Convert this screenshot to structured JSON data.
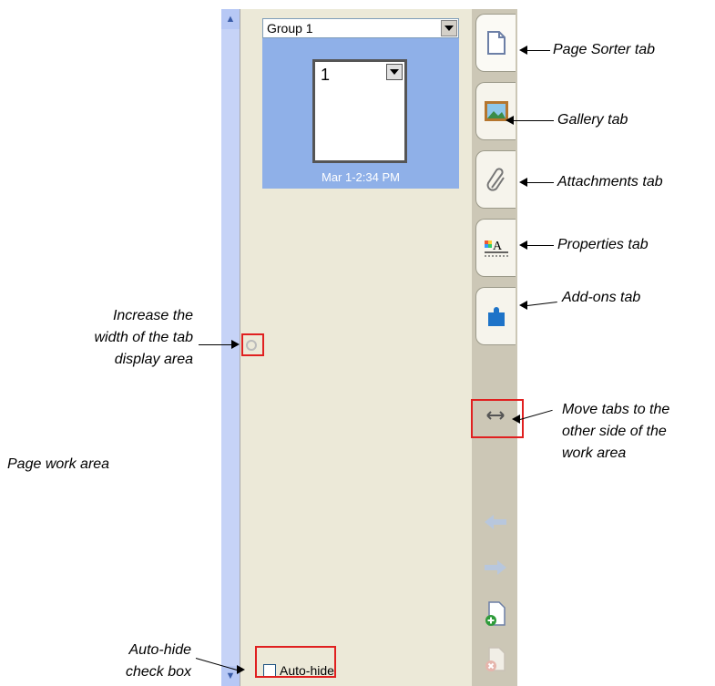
{
  "panel": {
    "group_select_value": "Group 1",
    "page_number": "1",
    "page_timestamp": "Mar 1-2:34 PM",
    "autohide_label": "Auto-hide",
    "autohide_checked": false
  },
  "tabs": [
    {
      "name": "Page Sorter",
      "icon": "page-icon",
      "active": true
    },
    {
      "name": "Gallery",
      "icon": "picture-icon",
      "active": false
    },
    {
      "name": "Attachments",
      "icon": "paperclip-icon",
      "active": false
    },
    {
      "name": "Properties",
      "icon": "properties-icon",
      "active": false
    },
    {
      "name": "Add-ons",
      "icon": "puzzle-icon",
      "active": false
    }
  ],
  "callouts": {
    "page_sorter": "Page Sorter tab",
    "gallery": "Gallery tab",
    "attachments": "Attachments tab",
    "properties": "Properties tab",
    "addons": "Add-ons tab",
    "increase_width": [
      "Increase the",
      "width of the tab",
      "display area"
    ],
    "move_tabs": [
      "Move tabs to the",
      "other side of the",
      "work area"
    ],
    "page_work_area": "Page work area",
    "autohide_checkbox": [
      "Auto-hide",
      "check box"
    ]
  },
  "colors": {
    "highlight": "#e02020",
    "thumb_bg": "#8fb0e8",
    "panel_bg": "#ece9d8",
    "tabstrip_bg": "#ccc7b6"
  }
}
